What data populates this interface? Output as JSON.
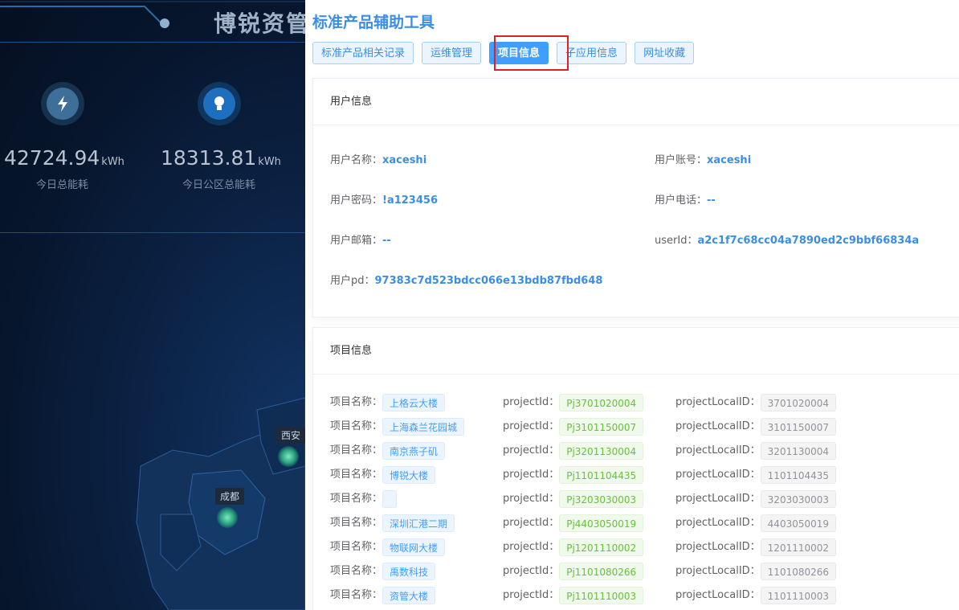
{
  "dashboard": {
    "title": "博锐资管",
    "stats": [
      {
        "value": "42724.94",
        "unit": "kWh",
        "label": "今日总能耗",
        "icon": "lightning-icon"
      },
      {
        "value": "18313.81",
        "unit": "kWh",
        "label": "今日公区总能耗",
        "icon": "lightbulb-icon"
      }
    ],
    "cities": [
      "西安",
      "成都"
    ]
  },
  "drawer": {
    "title": "标准产品辅助工具",
    "tabs": [
      {
        "label": "标准产品相关记录"
      },
      {
        "label": "运维管理"
      },
      {
        "label": "项目信息"
      },
      {
        "label": "子应用信息"
      },
      {
        "label": "网址收藏"
      }
    ],
    "active_tab": "项目信息"
  },
  "user_info": {
    "header": "用户信息",
    "fields": [
      {
        "label": "用户名称：",
        "value": "xaceshi"
      },
      {
        "label": "用户账号：",
        "value": "xaceshi"
      },
      {
        "label": "用户密码：",
        "value": "!a123456"
      },
      {
        "label": "用户电话：",
        "value": "--"
      },
      {
        "label": "用户邮箱：",
        "value": "--"
      },
      {
        "label": "userId：",
        "value": "a2c1f7c68cc04a7890ed2c9bbf66834a"
      },
      {
        "label": "用户pd：",
        "value": "97383c7d523bdcc066e13bdb87fbd648"
      }
    ]
  },
  "project_info": {
    "header": "项目信息",
    "name_label": "项目名称：",
    "id_label": "projectId：",
    "local_id_label": "projectLocalID：",
    "rows": [
      {
        "name": "上格云大楼",
        "projectId": "Pj3701020004",
        "projectLocalID": "3701020004"
      },
      {
        "name": "上海森兰花园城",
        "projectId": "Pj3101150007",
        "projectLocalID": "3101150007"
      },
      {
        "name": "南京燕子矶",
        "projectId": "Pj3201130004",
        "projectLocalID": "3201130004"
      },
      {
        "name": "博锐大楼",
        "projectId": "Pj1101104435",
        "projectLocalID": "1101104435"
      },
      {
        "name": "",
        "projectId": "Pj3203030003",
        "projectLocalID": "3203030003"
      },
      {
        "name": "深圳汇港二期",
        "projectId": "Pj4403050019",
        "projectLocalID": "4403050019"
      },
      {
        "name": "物联网大楼",
        "projectId": "Pj1201110002",
        "projectLocalID": "1201110002"
      },
      {
        "name": "禹数科技",
        "projectId": "Pj1101080266",
        "projectLocalID": "1101080266"
      },
      {
        "name": "资管大楼",
        "projectId": "Pj1101110003",
        "projectLocalID": "1101110003"
      }
    ]
  },
  "colors": {
    "accent": "#409eff",
    "highlight_box": "#e02020",
    "tag_green": "#67c23a",
    "tag_gray": "#909399"
  }
}
